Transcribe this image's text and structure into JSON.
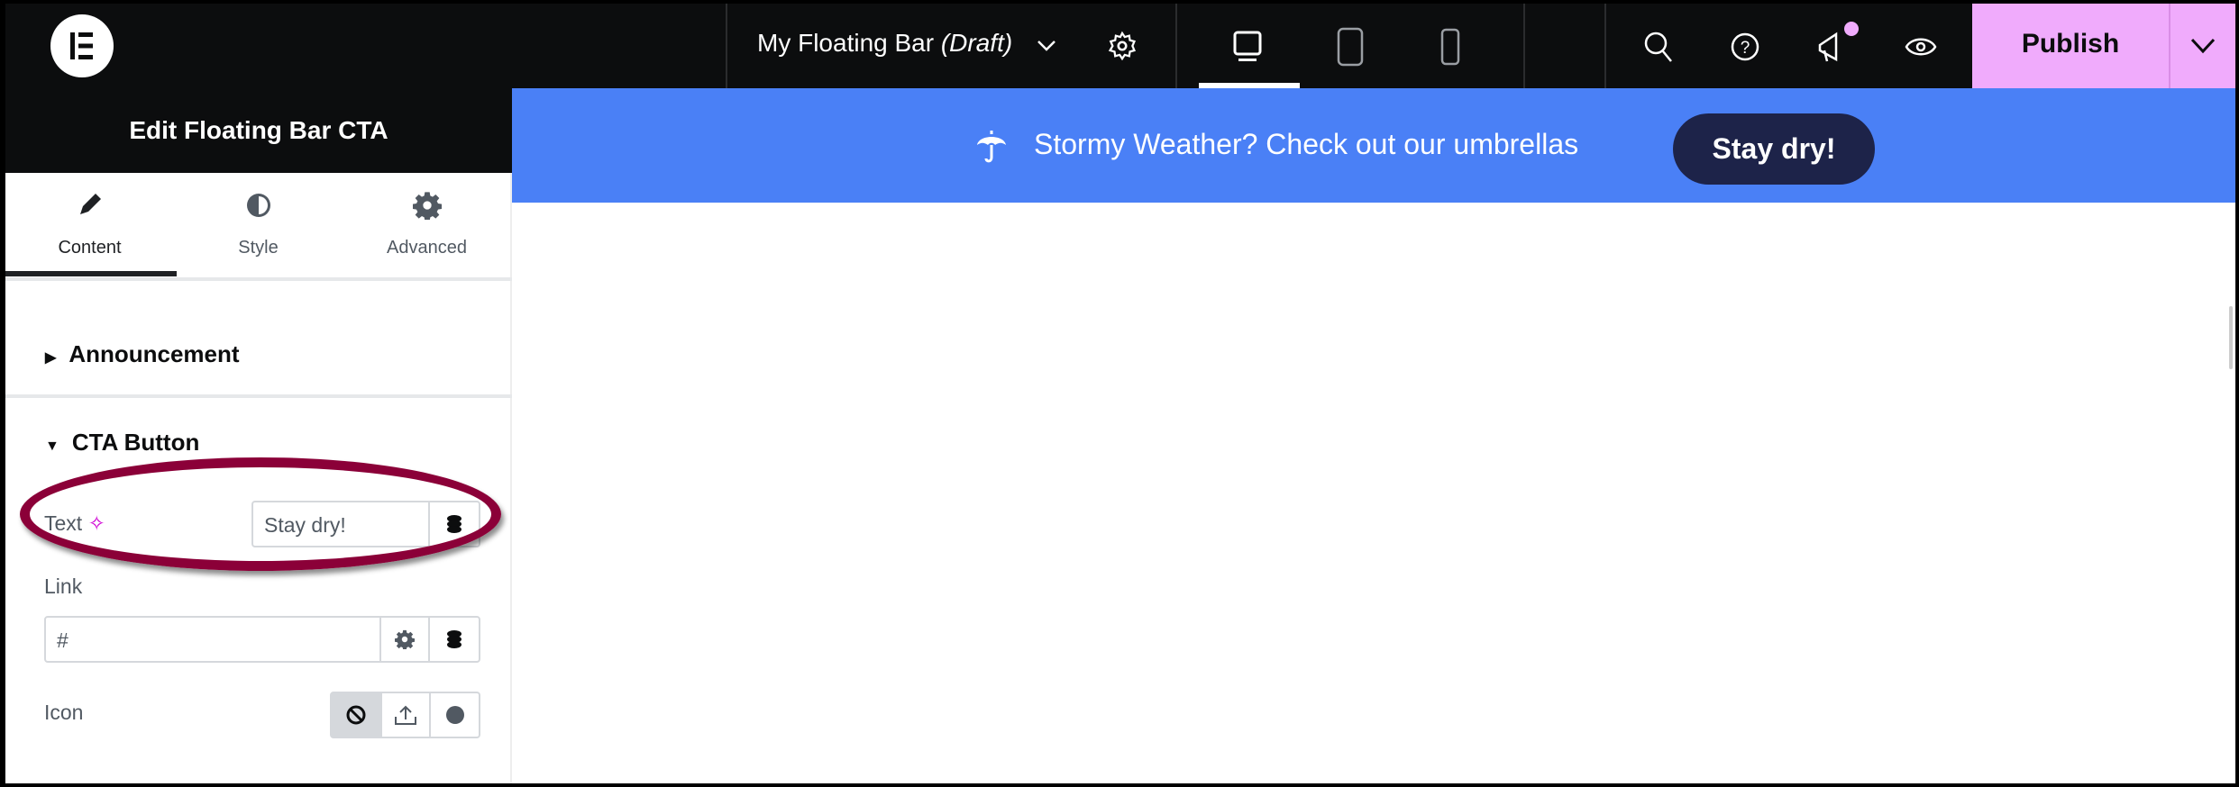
{
  "topbar": {
    "logo": "E",
    "document_title": "My Floating Bar",
    "document_status": "(Draft)",
    "icons": [
      "chevron-down-icon",
      "settings-icon",
      "desktop-icon",
      "tablet-icon",
      "mobile-icon",
      "search-icon",
      "help-icon",
      "megaphone-icon",
      "eye-icon"
    ],
    "active_device": "desktop",
    "notification_dot_color": "#f0abfc",
    "publish_label": "Publish",
    "publish_color": "#f0abfc"
  },
  "canvas": {
    "bar_color": "#4a80f6",
    "message_icon": "umbrella-icon",
    "message": "Stormy Weather? Check out our umbrellas",
    "button_label": "Stay dry!",
    "button_color": "#1d2349"
  },
  "panel": {
    "title": "Edit Floating Bar CTA",
    "tabs": [
      {
        "label": "Content",
        "icon": "pencil-icon",
        "active": true
      },
      {
        "label": "Style",
        "icon": "contrast-icon",
        "active": false
      },
      {
        "label": "Advanced",
        "icon": "gear-icon",
        "active": false
      }
    ],
    "sections": [
      {
        "title": "Announcement",
        "expanded": false
      },
      {
        "title": "CTA Button",
        "expanded": true
      }
    ],
    "fields": {
      "text_label": "Text",
      "text_value": "Stay dry!",
      "link_label": "Link",
      "link_value": "#",
      "icon_label": "Icon",
      "icon_options": [
        "none-icon",
        "upload-icon",
        "circle-icon"
      ],
      "icon_selected": "none-icon"
    },
    "highlight_color": "#8b0038"
  }
}
